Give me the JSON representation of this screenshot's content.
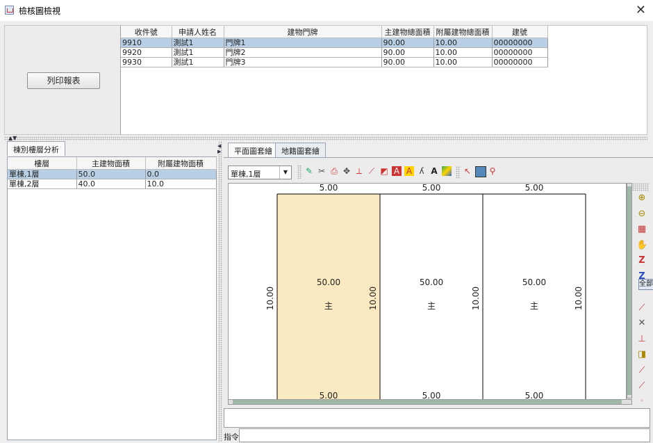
{
  "window": {
    "title": "檢核圖檢視",
    "close_glyph": "✕"
  },
  "top": {
    "print_button": "列印報表",
    "columns": [
      "收件號",
      "申請人姓名",
      "建物門牌",
      "主建物總面積",
      "附屬建物總面積",
      "建號"
    ],
    "rows": [
      [
        "9910",
        "測試1",
        "門牌1",
        "90.00",
        "10.00",
        "00000000"
      ],
      [
        "9920",
        "測試1",
        "門牌2",
        "90.00",
        "10.00",
        "00000000"
      ],
      [
        "9930",
        "測試1",
        "門牌3",
        "90.00",
        "10.00",
        "00000000"
      ]
    ],
    "selected_row": 0
  },
  "left": {
    "tab": "棟別樓層分析",
    "columns": [
      "樓層",
      "主建物面積",
      "附屬建物面積"
    ],
    "rows": [
      [
        "單棟,1層",
        "50.0",
        "0.0"
      ],
      [
        "單棟,2層",
        "40.0",
        "10.0"
      ]
    ],
    "selected_row": 0
  },
  "right": {
    "tabs": [
      "平面圖套繪",
      "地籍圖套繪"
    ],
    "floor_select": "單棟,1層",
    "floor_arrow": "▼",
    "right_tooltip": "全部",
    "command_label": "指令:",
    "command_value": "",
    "plan": {
      "top_widths": [
        "5.00",
        "5.00",
        "5.00"
      ],
      "bottom_widths": [
        "5.00",
        "5.00",
        "5.00"
      ],
      "heights": [
        "10.00",
        "10.00",
        "10.00",
        "10.00"
      ],
      "areas": [
        "50.00",
        "50.00",
        "50.00"
      ],
      "kinds": [
        "主",
        "主",
        "主"
      ],
      "highlight_color": "#fbe9c1"
    }
  }
}
